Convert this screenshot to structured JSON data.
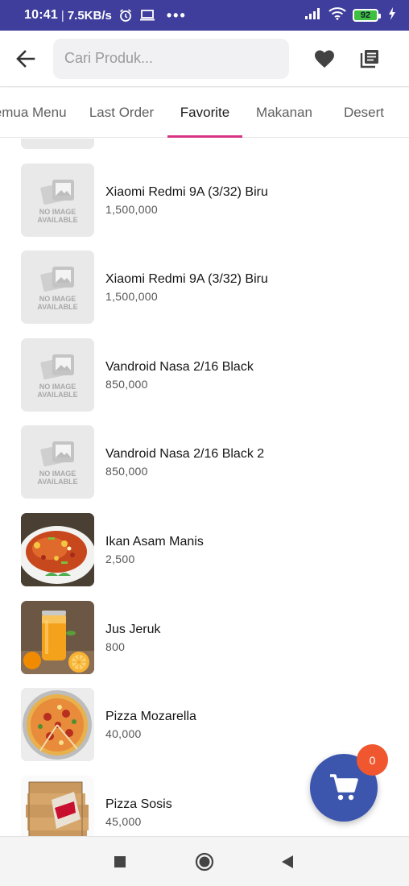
{
  "status_bar": {
    "time": "10:41",
    "separator": "|",
    "net_speed": "7.5KB/s",
    "more": "•••",
    "battery_level": "92",
    "icons": [
      "alarm-icon",
      "laptop-icon",
      "signal-icon",
      "wifi-icon",
      "battery-icon",
      "charging-icon"
    ]
  },
  "header": {
    "search_placeholder": "Cari Produk...",
    "icons": [
      "back-arrow-icon",
      "heart-icon",
      "library-books-icon"
    ]
  },
  "tabs": [
    {
      "label": "Semua Menu"
    },
    {
      "label": "Last Order"
    },
    {
      "label": "Favorite",
      "active": true
    },
    {
      "label": "Makanan"
    },
    {
      "label": "Desert"
    }
  ],
  "no_image": {
    "line1": "NO IMAGE",
    "line2": "AVAILABLE"
  },
  "products": [
    {
      "name": "Xiaomi Redmi 9A (3/32) Biru",
      "price": "1,500,000",
      "image": "no-image"
    },
    {
      "name": "Xiaomi Redmi 9A (3/32) Biru",
      "price": "1,500,000",
      "image": "no-image"
    },
    {
      "name": "Vandroid Nasa 2/16 Black",
      "price": "850,000",
      "image": "no-image"
    },
    {
      "name": "Vandroid Nasa 2/16 Black 2",
      "price": "850,000",
      "image": "no-image"
    },
    {
      "name": "Ikan Asam Manis",
      "price": "2,500",
      "image": "fish-dish-photo"
    },
    {
      "name": "Jus Jeruk",
      "price": "800",
      "image": "orange-juice-photo"
    },
    {
      "name": "Pizza Mozarella",
      "price": "40,000",
      "image": "pizza-photo"
    },
    {
      "name": "Pizza Sosis",
      "price": "45,000",
      "image": "pizza-box-photo"
    }
  ],
  "cart": {
    "count": "0"
  },
  "colors": {
    "status_bar": "#3f3e9c",
    "tab_indicator": "#d63384",
    "cart_button": "#3d56ad",
    "cart_badge": "#f0572e"
  }
}
